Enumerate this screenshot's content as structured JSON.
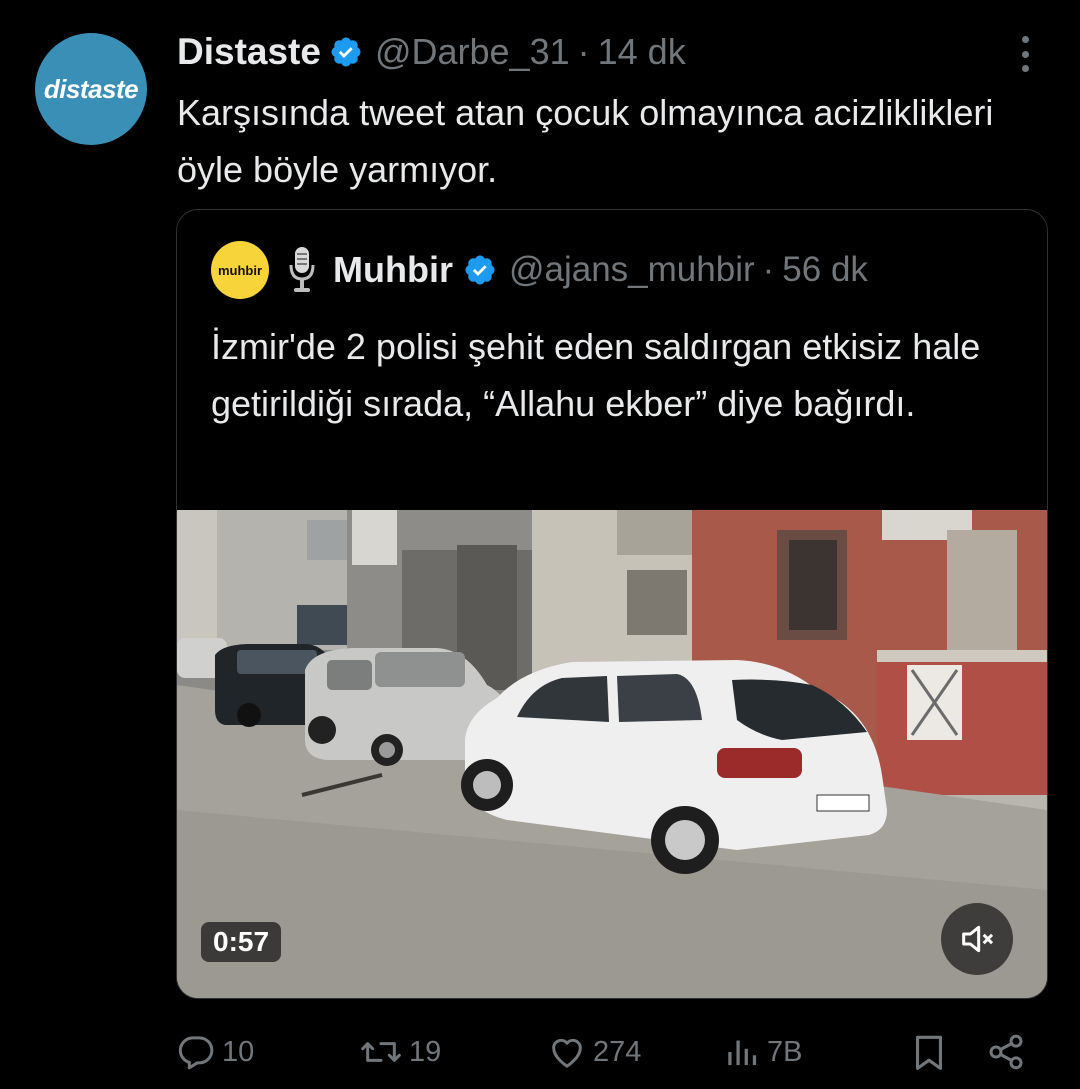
{
  "tweet": {
    "avatar_text": "distaste",
    "author_name": "Distaste",
    "author_handle": "@Darbe_31",
    "separator": "·",
    "time_ago": "14 dk",
    "text": "Karşısında tweet atan çocuk olmayınca acizliklikleri öyle böyle yarmıyor."
  },
  "quote": {
    "avatar_text": "muhbir",
    "author_name": "Muhbir",
    "author_handle": "@ajans_muhbir",
    "separator": "·",
    "time_ago": "56 dk",
    "text": "İzmir'de 2 polisi şehit eden saldırgan etkisiz hale getirildiği sırada, “Allahu ekber” diye bağırdı.",
    "video": {
      "duration": "0:57",
      "muted": true
    }
  },
  "actions": {
    "replies": "10",
    "reposts": "19",
    "likes": "274",
    "views": "7B"
  },
  "colors": {
    "background": "#000000",
    "primary_text": "#e7e9ea",
    "secondary_text": "#71767b",
    "verified_blue": "#1d9bf0",
    "card_border": "#2f3336",
    "distaste_avatar": "#3a8fb7",
    "muhbir_avatar": "#f6d43a"
  },
  "icons": [
    "verified-badge-icon",
    "more-icon",
    "microphone-icon",
    "mute-icon",
    "reply-icon",
    "repost-icon",
    "like-icon",
    "views-icon",
    "bookmark-icon",
    "share-icon"
  ]
}
